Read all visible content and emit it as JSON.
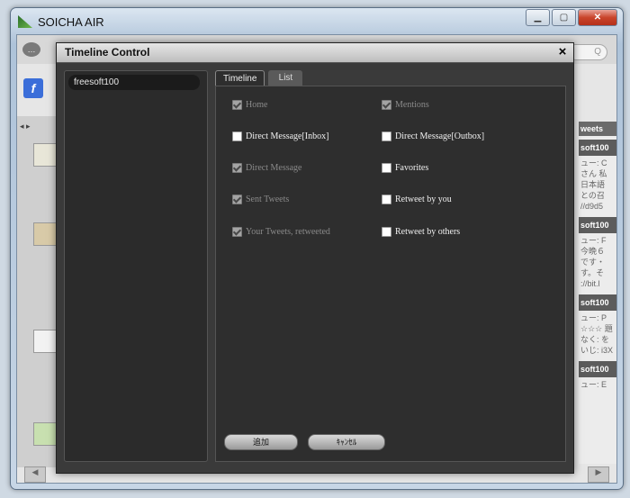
{
  "window": {
    "title": "SOICHA AIR",
    "controls": [
      "minimize",
      "maximize",
      "close"
    ]
  },
  "background": {
    "right_col_header": "weets",
    "entries": [
      {
        "name": "soft100",
        "text": "ュー: C さん 私 日本語 との召 //d9d5"
      },
      {
        "name": "soft100",
        "text": "ュー: F 今晩６ です・ す。そ ://bit.l"
      },
      {
        "name": "soft100",
        "text": "ュー: P ☆☆☆ 題なく: をいじ: i3X"
      },
      {
        "name": "soft100",
        "text": "ュー: E"
      }
    ]
  },
  "dialog": {
    "title": "Timeline Control",
    "close_label": "×",
    "accounts": [
      "freesoft100"
    ],
    "tabs": [
      {
        "label": "Timeline",
        "active": true
      },
      {
        "label": "List",
        "active": false
      }
    ],
    "options": [
      {
        "label": "Home",
        "checked": true,
        "enabled": false
      },
      {
        "label": "Mentions",
        "checked": true,
        "enabled": false
      },
      {
        "label": "Direct Message[Inbox]",
        "checked": false,
        "enabled": true
      },
      {
        "label": "Direct Message[Outbox]",
        "checked": false,
        "enabled": true
      },
      {
        "label": "Direct Message",
        "checked": true,
        "enabled": false
      },
      {
        "label": "Favorites",
        "checked": false,
        "enabled": true
      },
      {
        "label": "Sent Tweets",
        "checked": true,
        "enabled": false
      },
      {
        "label": "Retweet by you",
        "checked": false,
        "enabled": true
      },
      {
        "label": "Your Tweets, retweeted",
        "checked": true,
        "enabled": false
      },
      {
        "label": "Retweet by others",
        "checked": false,
        "enabled": true
      }
    ],
    "buttons": {
      "add": "追加",
      "cancel": "ｷｬﾝｾﾙ"
    }
  }
}
